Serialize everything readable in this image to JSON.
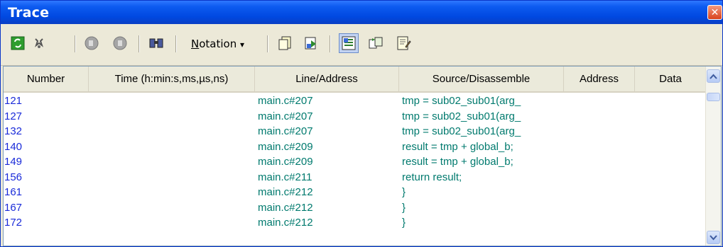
{
  "window": {
    "title": "Trace"
  },
  "toolbar": {
    "notation_label_underlined": "N",
    "notation_label_rest": "otation",
    "notation_arrow": "▾",
    "icons": [
      "refresh-icon",
      "pin-icon",
      "step-back-icon",
      "step-forward-icon",
      "find-icon",
      "copy-icon",
      "export-icon",
      "mixed-view-icon",
      "link-icon",
      "edit-icon"
    ]
  },
  "columns": {
    "number": "Number",
    "time": "Time (h:min:s,ms,µs,ns)",
    "line": "Line/Address",
    "source": "Source/Disassemble",
    "address": "Address",
    "data": "Data"
  },
  "rows": [
    {
      "number": "121",
      "time": "",
      "line": "main.c#207",
      "source": "tmp = sub02_sub01(arg_",
      "address": "",
      "data": ""
    },
    {
      "number": "127",
      "time": "",
      "line": "main.c#207",
      "source": "tmp = sub02_sub01(arg_",
      "address": "",
      "data": ""
    },
    {
      "number": "132",
      "time": "",
      "line": "main.c#207",
      "source": "tmp = sub02_sub01(arg_",
      "address": "",
      "data": ""
    },
    {
      "number": "140",
      "time": "",
      "line": "main.c#209",
      "source": "result = tmp + global_b;",
      "address": "",
      "data": ""
    },
    {
      "number": "149",
      "time": "",
      "line": "main.c#209",
      "source": "result = tmp + global_b;",
      "address": "",
      "data": ""
    },
    {
      "number": "156",
      "time": "",
      "line": "main.c#211",
      "source": "return result;",
      "address": "",
      "data": ""
    },
    {
      "number": "161",
      "time": "",
      "line": "main.c#212",
      "source": "}",
      "address": "",
      "data": ""
    },
    {
      "number": "167",
      "time": "",
      "line": "main.c#212",
      "source": "}",
      "address": "",
      "data": ""
    },
    {
      "number": "172",
      "time": "",
      "line": "main.c#212",
      "source": "}",
      "address": "",
      "data": ""
    }
  ],
  "colors": {
    "title_bar": "#0048e0",
    "number_text": "#1a2bd9",
    "code_text": "#007a6e"
  }
}
